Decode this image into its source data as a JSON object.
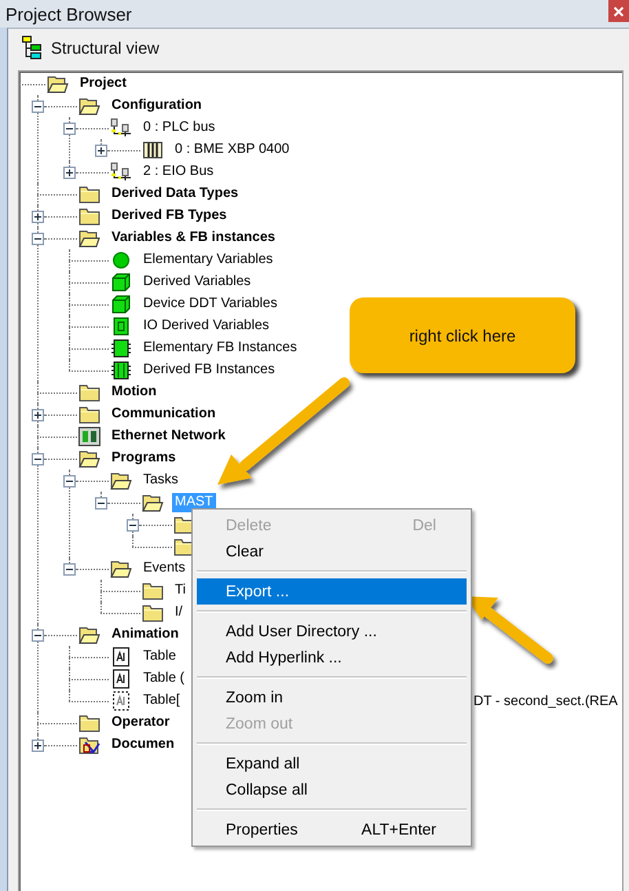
{
  "window": {
    "title": "Project Browser"
  },
  "toolbar": {
    "view_label": "Structural view"
  },
  "tree": [
    {
      "label": "Project",
      "kind": "folder",
      "bold": true,
      "selected": false,
      "children": [
        {
          "label": "Configuration",
          "kind": "folder",
          "bold": true,
          "expanded": true,
          "selected": false,
          "children": [
            {
              "label": "0 : PLC bus",
              "kind": "bus",
              "bold": false,
              "expanded": true,
              "selected": false,
              "children": [
                {
                  "label": "0 : BME XBP 0400",
                  "kind": "rack",
                  "bold": false,
                  "expanded": false,
                  "selected": false
                }
              ]
            },
            {
              "label": "2 : EIO Bus",
              "kind": "bus",
              "bold": false,
              "expanded": false,
              "selected": false
            }
          ]
        },
        {
          "label": "Derived Data Types",
          "kind": "folder",
          "bold": true,
          "selected": false
        },
        {
          "label": "Derived FB Types",
          "kind": "folder",
          "bold": true,
          "expanded": false,
          "selected": false
        },
        {
          "label": "Variables & FB instances",
          "kind": "folder",
          "bold": true,
          "expanded": true,
          "selected": false,
          "children": [
            {
              "label": "Elementary Variables",
              "kind": "var-elementary",
              "bold": false,
              "selected": false
            },
            {
              "label": "Derived Variables",
              "kind": "var-derived",
              "bold": false,
              "selected": false
            },
            {
              "label": "Device DDT Variables",
              "kind": "var-derived",
              "bold": false,
              "selected": false
            },
            {
              "label": "IO Derived Variables",
              "kind": "var-io",
              "bold": false,
              "selected": false
            },
            {
              "label": "Elementary FB Instances",
              "kind": "fb",
              "bold": false,
              "selected": false
            },
            {
              "label": "Derived FB Instances",
              "kind": "fb-derived",
              "bold": false,
              "selected": false
            }
          ]
        },
        {
          "label": "Motion",
          "kind": "folder",
          "bold": true,
          "selected": false
        },
        {
          "label": "Communication",
          "kind": "folder",
          "bold": true,
          "expanded": false,
          "selected": false
        },
        {
          "label": "Ethernet Network",
          "kind": "network",
          "bold": true,
          "selected": false
        },
        {
          "label": "Programs",
          "kind": "folder",
          "bold": true,
          "expanded": true,
          "selected": false,
          "children": [
            {
              "label": "Tasks",
              "kind": "folder",
              "bold": false,
              "expanded": true,
              "selected": false,
              "children": [
                {
                  "label": "MAST",
                  "kind": "folder",
                  "bold": false,
                  "expanded": true,
                  "selected": true,
                  "children": [
                    {
                      "kind": "folder",
                      "expanded": true
                    },
                    {
                      "kind": "folder"
                    }
                  ]
                }
              ]
            },
            {
              "label": "Events",
              "kind": "folder",
              "bold": false,
              "expanded": true,
              "selected": false,
              "children": [
                {
                  "label": "Ti",
                  "kind": "folder",
                  "bold": false,
                  "selected": false
                },
                {
                  "label": "I/",
                  "kind": "folder",
                  "bold": false,
                  "selected": false
                }
              ]
            }
          ]
        },
        {
          "label": "Animation",
          "kind": "folder",
          "bold": true,
          "expanded": true,
          "selected": false,
          "children": [
            {
              "label": "Table",
              "kind": "table",
              "bold": false,
              "selected": false
            },
            {
              "label": "Table (",
              "kind": "table",
              "bold": false,
              "selected": false
            },
            {
              "label": "Table[",
              "kind": "table-unsaved",
              "bold": false,
              "selected": false,
              "tail": "DT - second_sect.(REA"
            }
          ]
        },
        {
          "label": "Operator",
          "kind": "folder",
          "bold": true,
          "selected": false
        },
        {
          "label": "Documen",
          "kind": "document",
          "bold": true,
          "expanded": false,
          "selected": false
        }
      ]
    }
  ],
  "context_menu": [
    {
      "kind": "item",
      "label": "Delete",
      "shortcut": "Del",
      "disabled": true,
      "selected": false
    },
    {
      "kind": "item",
      "label": "Clear",
      "disabled": false,
      "selected": false
    },
    {
      "kind": "separator"
    },
    {
      "kind": "item",
      "label": "Export ...",
      "disabled": false,
      "selected": true
    },
    {
      "kind": "separator"
    },
    {
      "kind": "item",
      "label": "Add User Directory ...",
      "disabled": false,
      "selected": false
    },
    {
      "kind": "item",
      "label": "Add Hyperlink ...",
      "disabled": false,
      "selected": false
    },
    {
      "kind": "separator"
    },
    {
      "kind": "item",
      "label": "Zoom in",
      "disabled": false,
      "selected": false
    },
    {
      "kind": "item",
      "label": "Zoom out",
      "disabled": true,
      "selected": false
    },
    {
      "kind": "separator"
    },
    {
      "kind": "item",
      "label": "Expand all",
      "disabled": false,
      "selected": false
    },
    {
      "kind": "item",
      "label": "Collapse all",
      "disabled": false,
      "selected": false
    },
    {
      "kind": "separator"
    },
    {
      "kind": "item",
      "label": "Properties",
      "shortcut": "ALT+Enter",
      "disabled": false,
      "selected": false
    }
  ],
  "callout": {
    "text": "right click here"
  }
}
